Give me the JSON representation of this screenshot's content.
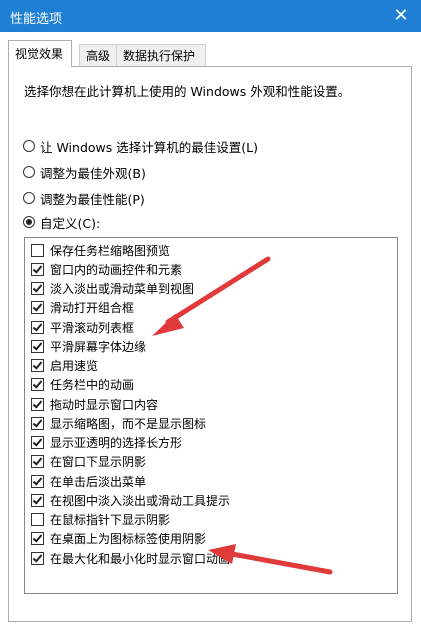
{
  "window": {
    "title": "性能选项",
    "close_glyph": "✕"
  },
  "tabs": [
    {
      "label": "视觉效果",
      "active": true
    },
    {
      "label": "高级",
      "active": false
    },
    {
      "label": "数据执行保护",
      "active": false
    }
  ],
  "visual_effects": {
    "description": "选择你想在此计算机上使用的 Windows 外观和性能设置。",
    "radios": [
      {
        "label": "让 Windows 选择计算机的最佳设置(L)",
        "selected": false
      },
      {
        "label": "调整为最佳外观(B)",
        "selected": false
      },
      {
        "label": "调整为最佳性能(P)",
        "selected": false
      },
      {
        "label": "自定义(C):",
        "selected": true
      }
    ],
    "options": [
      {
        "label": "保存任务栏缩略图预览",
        "checked": false
      },
      {
        "label": "窗口内的动画控件和元素",
        "checked": true
      },
      {
        "label": "淡入淡出或滑动菜单到视图",
        "checked": true
      },
      {
        "label": "滑动打开组合框",
        "checked": true
      },
      {
        "label": "平滑滚动列表框",
        "checked": true
      },
      {
        "label": "平滑屏幕字体边缘",
        "checked": true
      },
      {
        "label": "启用速览",
        "checked": true
      },
      {
        "label": "任务栏中的动画",
        "checked": true
      },
      {
        "label": "拖动时显示窗口内容",
        "checked": true
      },
      {
        "label": "显示缩略图，而不是显示图标",
        "checked": true
      },
      {
        "label": "显示亚透明的选择长方形",
        "checked": true
      },
      {
        "label": "在窗口下显示阴影",
        "checked": true
      },
      {
        "label": "在单击后淡出菜单",
        "checked": true
      },
      {
        "label": "在视图中淡入淡出或滑动工具提示",
        "checked": true
      },
      {
        "label": "在鼠标指针下显示阴影",
        "checked": false
      },
      {
        "label": "在桌面上为图标标签使用阴影",
        "checked": true
      },
      {
        "label": "在最大化和最小化时显示窗口动画",
        "checked": true
      }
    ]
  },
  "colors": {
    "titlebar": "#1f7fd4",
    "annotation_arrow": "#e03a3a"
  }
}
